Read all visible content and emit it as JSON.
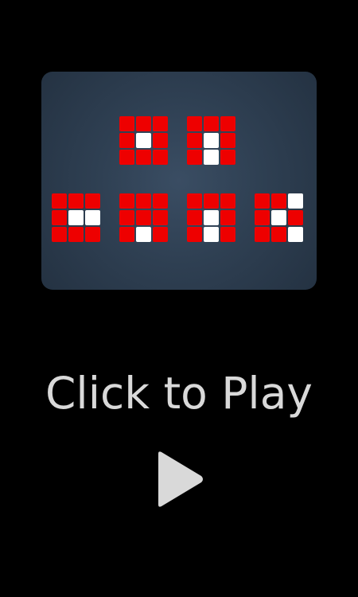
{
  "preview": {
    "patterns": [
      {
        "cells": [
          "R",
          "R",
          "R",
          "R",
          "W",
          "R",
          "R",
          "R",
          "R"
        ]
      },
      {
        "cells": [
          "R",
          "R",
          "R",
          "R",
          "W",
          "R",
          "R",
          "W",
          "R"
        ]
      },
      {
        "cells": [
          "R",
          "R",
          "R",
          "R",
          "W",
          "W",
          "R",
          "R",
          "R"
        ]
      },
      {
        "cells": [
          "R",
          "R",
          "R",
          "R",
          "R",
          "R",
          "R",
          "W",
          "R"
        ]
      },
      {
        "cells": [
          "R",
          "R",
          "R",
          "R",
          "W",
          "R",
          "R",
          "W",
          "R"
        ]
      },
      {
        "cells": [
          "R",
          "R",
          "W",
          "R",
          "W",
          "R",
          "R",
          "R",
          "W"
        ]
      }
    ],
    "colors": {
      "red": "#ee0000",
      "white": "#ffffff",
      "panel": "#2f4053"
    }
  },
  "cta": {
    "title": "Click to Play",
    "play_icon": "play-icon",
    "text_color": "#d9d9d9"
  }
}
